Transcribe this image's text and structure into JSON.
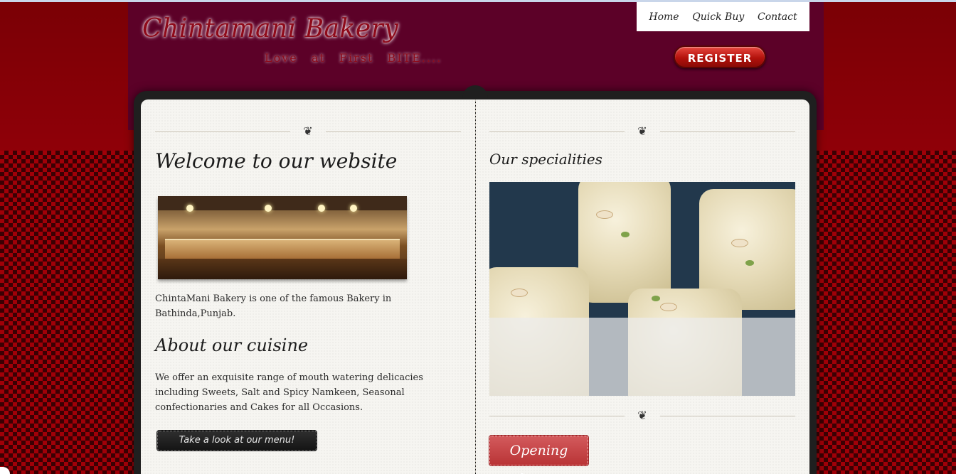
{
  "header": {
    "brand": "Chintamani Bakery",
    "tagline": "Love at First BITE...."
  },
  "nav": {
    "items": [
      {
        "label": "Home"
      },
      {
        "label": "Quick Buy"
      },
      {
        "label": "Contact"
      }
    ],
    "register_label": "REGISTER"
  },
  "left": {
    "welcome_heading": "Welcome to our website",
    "intro_text": "ChintaMani Bakery is one of the famous Bakery in Bathinda,Punjab.",
    "about_heading": "About our cuisine",
    "about_text": "We offer an exquisite range of mouth watering delicacies including Sweets, Salt and Spicy Namkeen, Seasonal confectionaries and Cakes for all Occasions.",
    "menu_button": "Take a look at our menu!"
  },
  "right": {
    "specialities_heading": "Our specialities",
    "hours_button": "Opening hours"
  },
  "ornament_glyph": "❦",
  "colors": {
    "background": "#8a0006",
    "header_band": "#5c0128",
    "brand_text": "#8e0a1a",
    "register_red": "#c2160f",
    "hours_button": "#c44546",
    "page": "#f6f5f1"
  }
}
